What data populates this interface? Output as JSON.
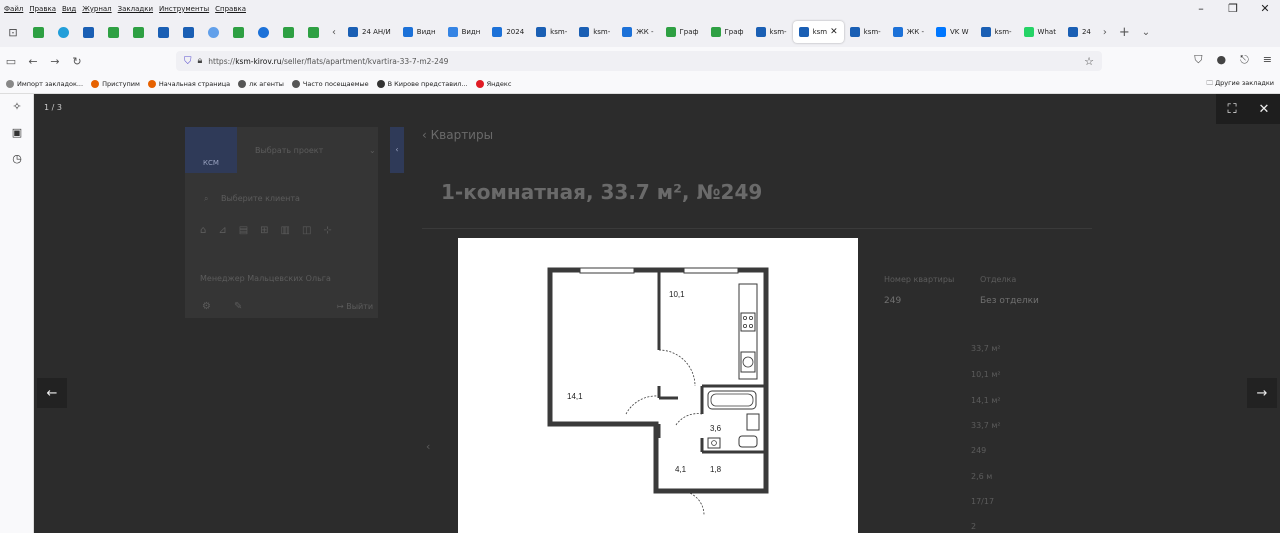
{
  "menu": [
    "Файл",
    "Правка",
    "Вид",
    "Журнал",
    "Закладки",
    "Инструменты",
    "Справка"
  ],
  "tabs": [
    {
      "label": "24 АН/И",
      "color": "#1a5fb4",
      "active": false
    },
    {
      "label": "Видн",
      "color": "#1c71d8",
      "active": false
    },
    {
      "label": "Видн",
      "color": "#3584e4",
      "active": false
    },
    {
      "label": "2024",
      "color": "#1c71d8",
      "active": false
    },
    {
      "label": "ksm-",
      "color": "#1a5fb4",
      "active": false
    },
    {
      "label": "ksm-",
      "color": "#1a5fb4",
      "active": false
    },
    {
      "label": "ЖК -",
      "color": "#1c71d8",
      "active": false
    },
    {
      "label": "Граф",
      "color": "#2ea043",
      "active": false
    },
    {
      "label": "Граф",
      "color": "#2ea043",
      "active": false
    },
    {
      "label": "ksm-",
      "color": "#1a5fb4",
      "active": false
    },
    {
      "label": "ksm",
      "color": "#1a5fb4",
      "active": true
    },
    {
      "label": "ksm-",
      "color": "#1a5fb4",
      "active": false
    },
    {
      "label": "ЖК -",
      "color": "#1c71d8",
      "active": false
    },
    {
      "label": "VK W",
      "color": "#0077ff",
      "active": false
    },
    {
      "label": "ksm-",
      "color": "#1a5fb4",
      "active": false
    },
    {
      "label": "What",
      "color": "#25d366",
      "active": false
    },
    {
      "label": "24",
      "color": "#1a5fb4",
      "active": false
    }
  ],
  "url": {
    "host": "ksm-kirov.ru",
    "prefix": "https://",
    "path": "/seller/flats/apartment/kvartira-33-7-m2-249"
  },
  "bookmarks": [
    {
      "label": "Импорт закладок...",
      "color": "#888"
    },
    {
      "label": "Приступим",
      "color": "#e66100"
    },
    {
      "label": "Начальная страница",
      "color": "#e66100"
    },
    {
      "label": "лк агенты",
      "color": "#555"
    },
    {
      "label": "Часто посещаемые",
      "color": "#555"
    },
    {
      "label": "В Кирове представил...",
      "color": "#333"
    },
    {
      "label": "Яндекс",
      "color": "#e01b24"
    }
  ],
  "bookmarks_other": "Другие закладки",
  "viewer": {
    "counter": "1 / 3"
  },
  "page": {
    "back_link": "Квартиры",
    "title": "1-комнатная, 33.7 м², №249",
    "select_project": "Выбрать проект",
    "select_client": "Выберите клиента",
    "manager": "Менеджер Мальцевских Ольга",
    "logout": "Выйти",
    "logo": "КСМ",
    "col_flat_number": "Номер квартиры",
    "col_finish": "Отделка",
    "flat_number": "249",
    "finish": "Без отделки",
    "values": [
      "33,7 м²",
      "10,1 м²",
      "14,1 м²",
      "33,7 м²",
      "249",
      "2,6 м",
      "17/17",
      "2"
    ]
  },
  "plan": {
    "rooms": [
      {
        "name": "kitchen",
        "area": "10,1"
      },
      {
        "name": "living",
        "area": "14,1"
      },
      {
        "name": "bath",
        "area": "3,6"
      },
      {
        "name": "hall",
        "area": "4,1"
      },
      {
        "name": "corridor",
        "area": "1,8"
      }
    ]
  }
}
